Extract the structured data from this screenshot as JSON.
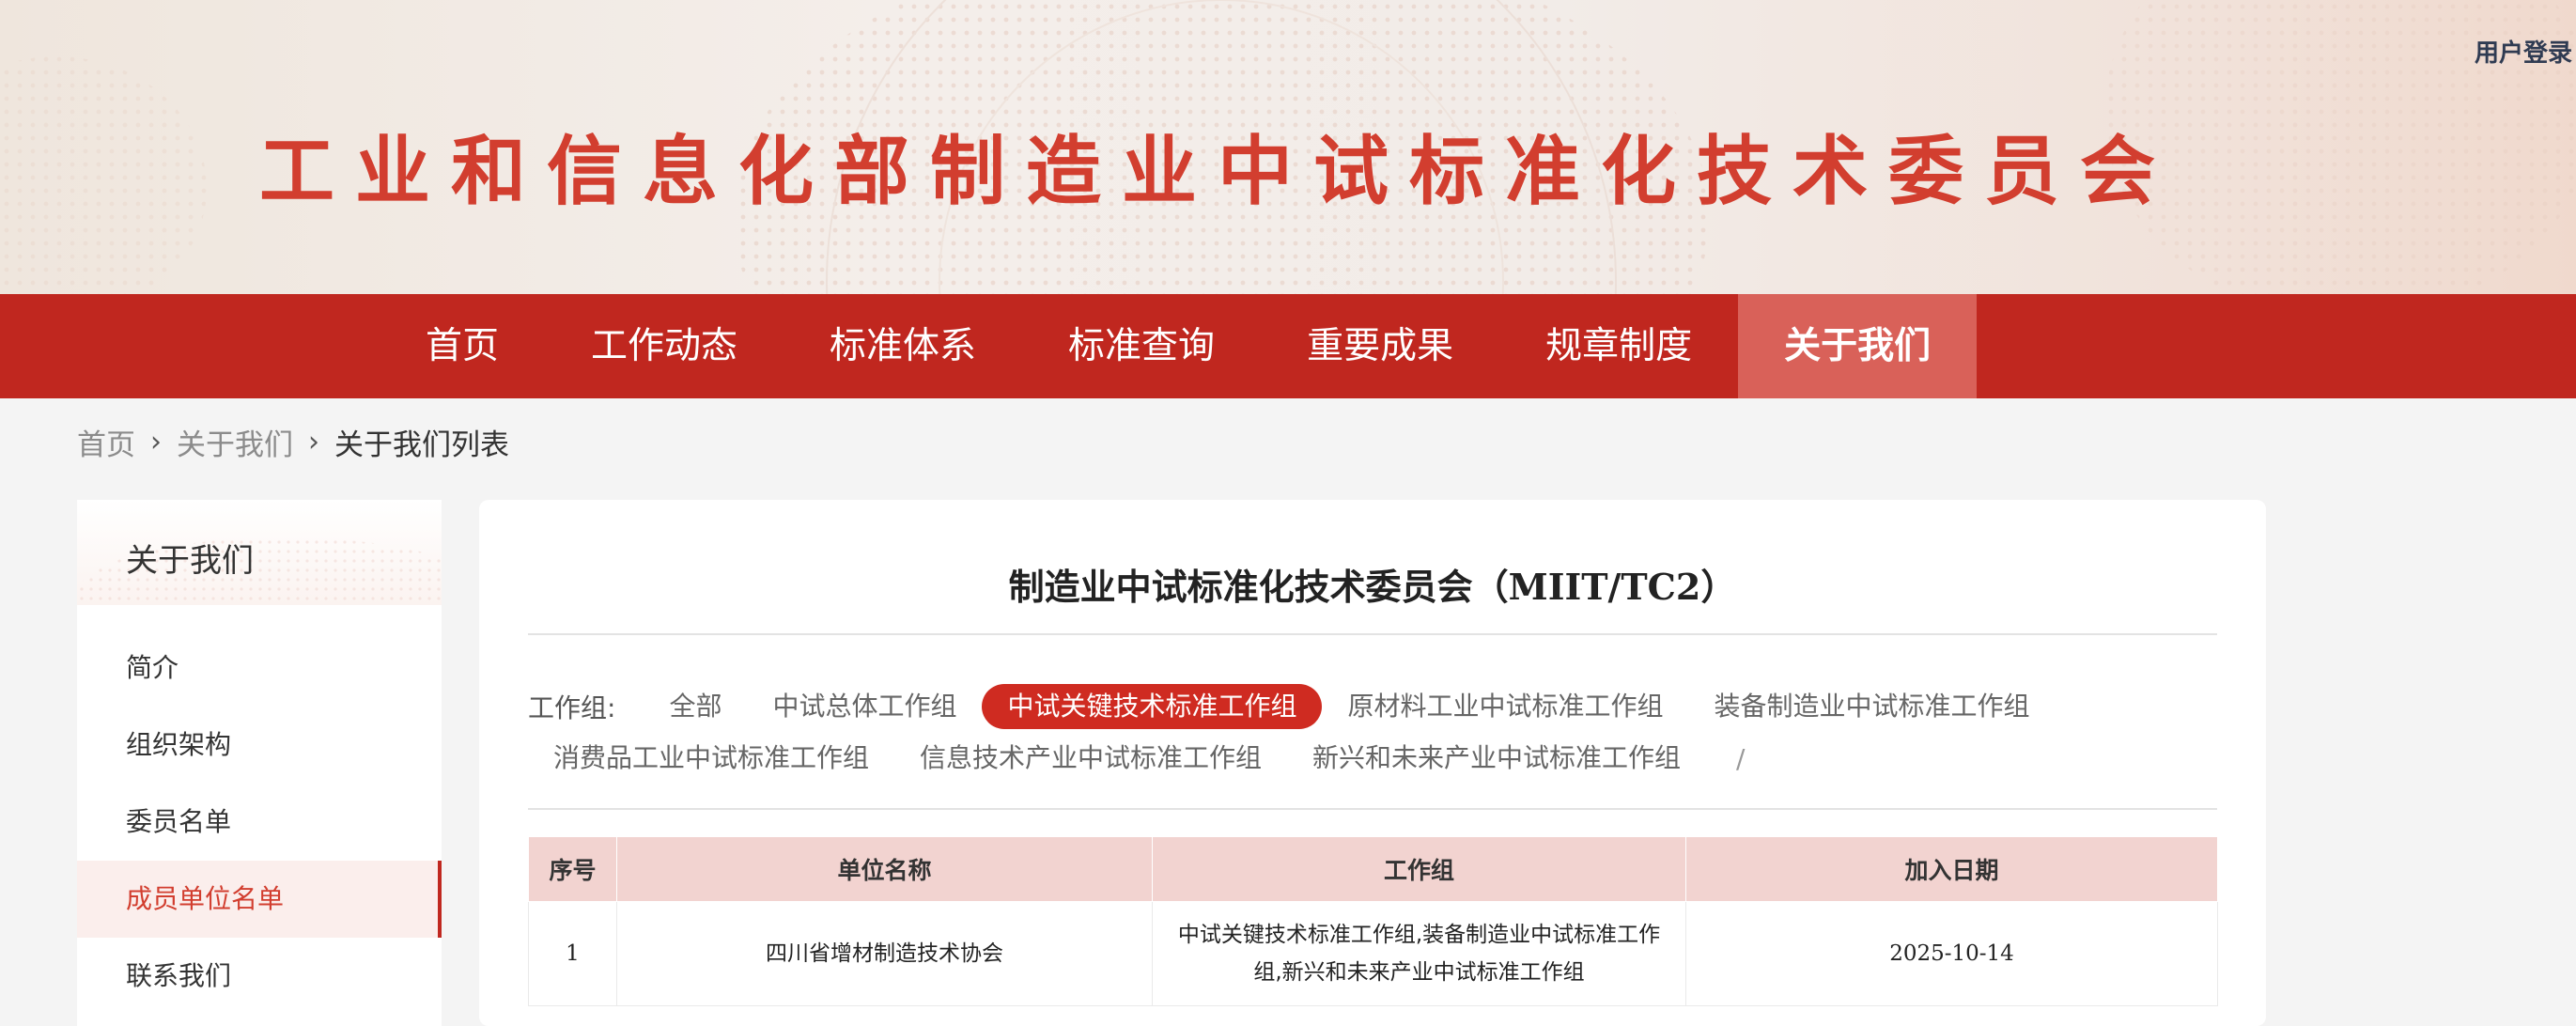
{
  "header": {
    "site_title": "工业和信息化部制造业中试标准化技术委员会",
    "login_label": "用户登录"
  },
  "nav": {
    "items": [
      "首页",
      "工作动态",
      "标准体系",
      "标准查询",
      "重要成果",
      "规章制度",
      "关于我们"
    ],
    "active_index": 6
  },
  "breadcrumb": {
    "home": "首页",
    "section": "关于我们",
    "current": "关于我们列表"
  },
  "sidebar": {
    "title": "关于我们",
    "items": [
      "简介",
      "组织架构",
      "委员名单",
      "成员单位名单",
      "联系我们"
    ],
    "active_index": 3
  },
  "main": {
    "title": "制造业中试标准化技术委员会（MIIT/TC2）",
    "group_label": "工作组:",
    "groups_row1": [
      "全部",
      "中试总体工作组",
      "中试关键技术标准工作组",
      "原材料工业中试标准工作组",
      "装备制造业中试标准工作组"
    ],
    "groups_row2": [
      "消费品工业中试标准工作组",
      "信息技术产业中试标准工作组",
      "新兴和未来产业中试标准工作组"
    ],
    "groups_separator": "/",
    "active_group": "中试关键技术标准工作组"
  },
  "table": {
    "columns": [
      "序号",
      "单位名称",
      "工作组",
      "加入日期"
    ],
    "rows": [
      {
        "index": "1",
        "name": "四川省增材制造技术协会",
        "group_line1": "中试关键技术标准工作组,装备制造业中试标准工作",
        "group_line2": "组,新兴和未来产业中试标准工作组",
        "date": "2025-10-14"
      }
    ]
  },
  "colors": {
    "brand_red": "#c0271f",
    "title_red": "#d23e2f",
    "table_header_bg": "#f2d3d0"
  }
}
